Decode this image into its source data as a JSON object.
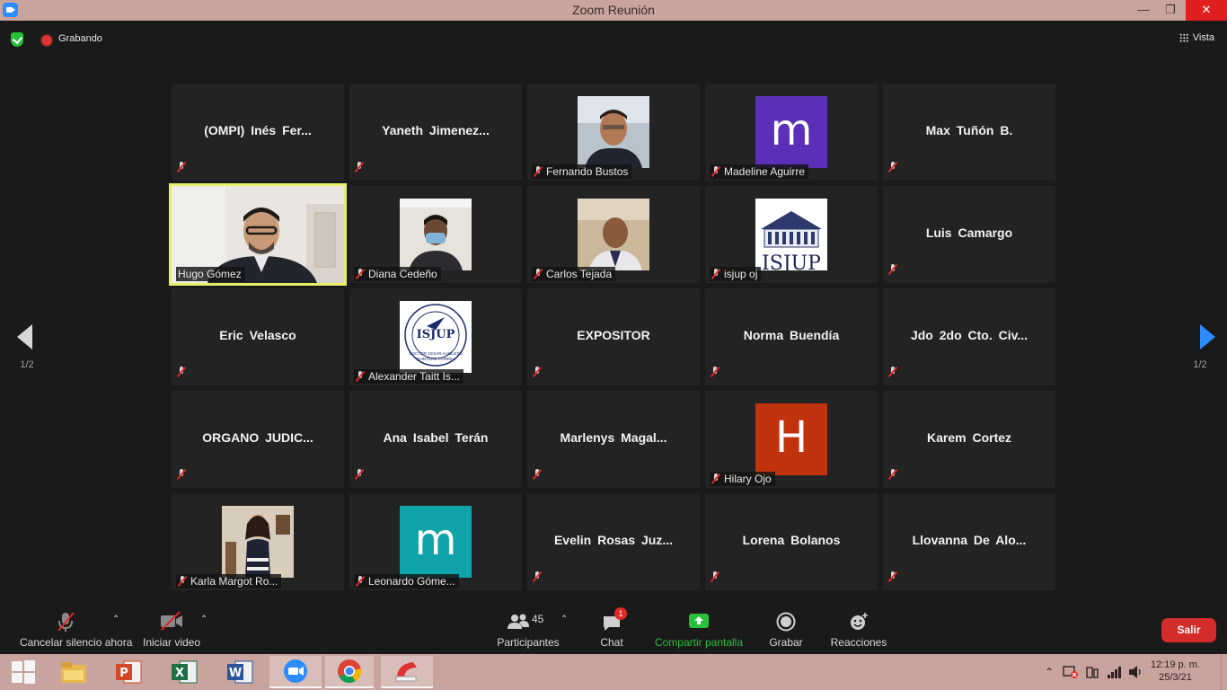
{
  "window": {
    "title": "Zoom Reunión",
    "minimize": "—",
    "restore": "❐",
    "close": "✕"
  },
  "meeting_bar": {
    "recording_label": "Grabando",
    "view_label": "Vista"
  },
  "pagination": {
    "left": "1/2",
    "right": "1/2"
  },
  "tiles": [
    {
      "name": "(OMPI) Inés Fer...",
      "type": "text"
    },
    {
      "name": "Yaneth  Jimenez...",
      "type": "text"
    },
    {
      "name": "Fernando Bustos",
      "type": "photo"
    },
    {
      "name": "Madeline Aguirre",
      "type": "avatar",
      "letter": "m",
      "color": "#5b2fb8"
    },
    {
      "name": "Max Tuñón B.",
      "type": "text"
    },
    {
      "name": "Hugo Gómez",
      "type": "video",
      "active": true
    },
    {
      "name": "Diana Cedeño",
      "type": "photo"
    },
    {
      "name": "Carlos Tejada",
      "type": "photo"
    },
    {
      "name": "isjup oj",
      "type": "logo"
    },
    {
      "name": "Luis Camargo",
      "type": "text"
    },
    {
      "name": "Eric Velasco",
      "type": "text"
    },
    {
      "name": "Alexander Taitt Is...",
      "type": "logo"
    },
    {
      "name": "EXPOSITOR",
      "type": "text"
    },
    {
      "name": "Norma Buendía",
      "type": "text"
    },
    {
      "name": "Jdo 2do  Cto.  Civ...",
      "type": "text"
    },
    {
      "name": "ORGANO  JUDIC...",
      "type": "text"
    },
    {
      "name": "Ana Isabel Terán",
      "type": "text"
    },
    {
      "name": "Marlenys  Magal...",
      "type": "text"
    },
    {
      "name": "Hilary Ojo",
      "type": "avatar",
      "letter": "H",
      "color": "#c1330e"
    },
    {
      "name": "Karem Cortez",
      "type": "text"
    },
    {
      "name": "Karla Margot Ro...",
      "type": "photo"
    },
    {
      "name": "Leonardo Góme...",
      "type": "avatar",
      "letter": "m",
      "color": "#0fa4a9"
    },
    {
      "name": "Evelin Rosas Juz...",
      "type": "text"
    },
    {
      "name": "Lorena Bolanos",
      "type": "text"
    },
    {
      "name": "Llovanna  De Alo...",
      "type": "text"
    }
  ],
  "logo_text": {
    "isjup_short": "ISJUP",
    "isjup_full": "ISJUP",
    "isjup_caption": "DOCTOR CÉSAR AUGUSTO QUINTERO CORREA"
  },
  "toolbar": {
    "unmute_label": "Cancelar silencio ahora",
    "video_label": "Iniciar video",
    "participants_label": "Participantes",
    "participants_count": "45",
    "chat_label": "Chat",
    "chat_badge": "1",
    "share_label": "Compartir pantalla",
    "record_label": "Grabar",
    "reactions_label": "Reacciones",
    "exit_label": "Salir"
  },
  "taskbar": {
    "time": "12:19 p. m.",
    "date": "25/3/21"
  },
  "colors": {
    "share_green": "#27c03b",
    "exit_red": "#d42b2b",
    "active_outline": "#e6ee6a",
    "nav_blue": "#2d8cff"
  }
}
